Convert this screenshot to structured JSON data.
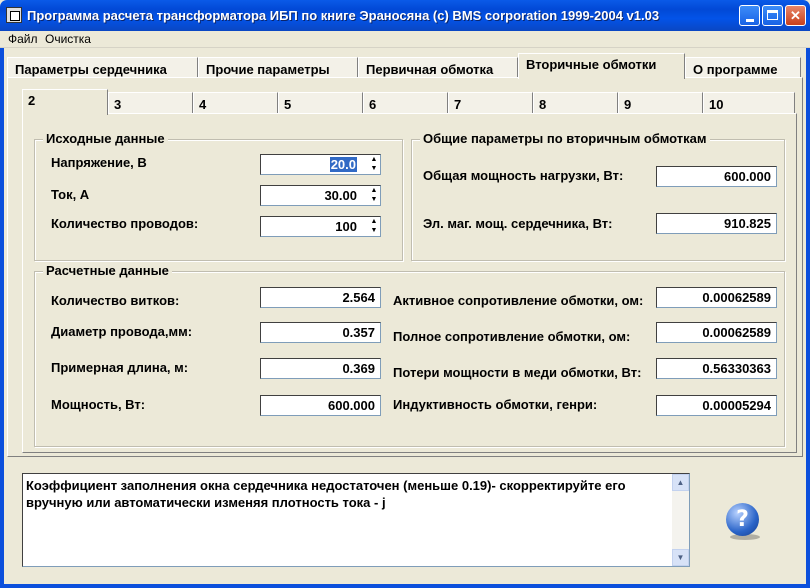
{
  "window": {
    "title": "Программа расчета трансформатора ИБП по книге Эраносяна        (c) BMS corporation 1999-2004  v1.03"
  },
  "menu": [
    "Файл",
    "Очистка"
  ],
  "main_tabs": [
    "Параметры сердечника",
    "Прочие параметры",
    "Первичная обмотка",
    "Вторичные обмотки",
    "О программе"
  ],
  "main_tab_active": "Вторичные обмотки",
  "sub_tabs": [
    "2",
    "3",
    "4",
    "5",
    "6",
    "7",
    "8",
    "9",
    "10"
  ],
  "sub_tab_active": "2",
  "input_group": {
    "title": "Исходные данные",
    "voltage": {
      "label": "Напряжение, В",
      "value": "20.0"
    },
    "current": {
      "label": "Ток, А",
      "value": "30.00"
    },
    "wires": {
      "label": "Количество проводов:",
      "value": "100"
    }
  },
  "general_group": {
    "title": "Общие параметры по вторичным обмоткам",
    "total_load": {
      "label": "Общая мощность нагрузки, Вт:",
      "value": "600.000"
    },
    "core_power": {
      "label": "Эл. маг. мощ. сердечника, Вт:",
      "value": "910.825"
    }
  },
  "calc_group": {
    "title": "Расчетные данные",
    "turns": {
      "label": "Количество витков:",
      "value": "2.564"
    },
    "diameter": {
      "label": "Диаметр провода,мм:",
      "value": "0.357"
    },
    "length": {
      "label": "Примерная длина, м:",
      "value": "0.369"
    },
    "power": {
      "label": "Мощность, Вт:",
      "value": "600.000"
    },
    "active_res": {
      "label": "Активное сопротивление обмотки, ом:",
      "value": "0.00062589"
    },
    "full_res": {
      "label": "Полное сопротивление обмотки, ом:",
      "value": "0.00062589"
    },
    "copper_loss": {
      "label": "Потери мощности в меди обмотки, Вт:",
      "value": "0.56330363"
    },
    "inductance": {
      "label": "Индуктивность обмотки, генри:",
      "value": "0.00005294"
    }
  },
  "message": "Коэффициент заполнения окна сердечника недостаточен (меньше 0.19)- скорректируйте его вручную или автоматически изменяя плотность тока - j",
  "icons": {
    "help": "help-question-icon",
    "app": "app-icon"
  }
}
